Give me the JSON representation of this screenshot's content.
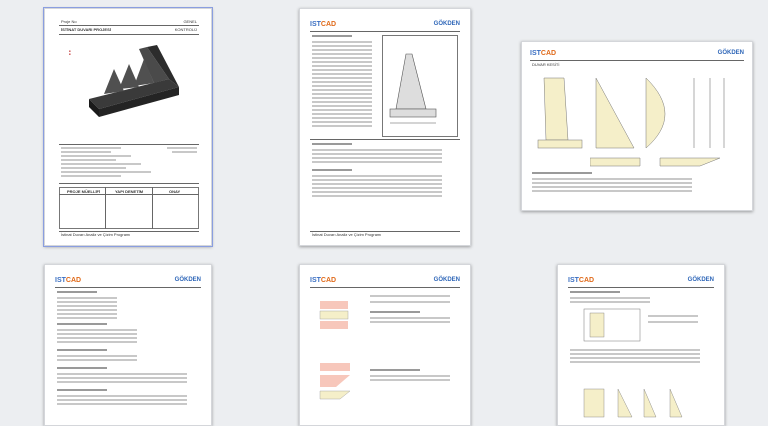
{
  "pages": [
    {
      "label": "page-1",
      "header_left": "Proje No",
      "header_right": "GENEL",
      "title": "İSTİNAT DUVARI PROJESİ",
      "title_right": "KONTROLÜ",
      "table_headers": [
        "PROJE MÜELLİFİ",
        "YAPI DENETİM",
        "ONAY"
      ],
      "footer": "İstinat Duvarı Analiz ve Çizim Programı"
    },
    {
      "label": "page-2",
      "logo_a": "IST",
      "logo_b": "CAD",
      "brand": "GÖKDEN",
      "footer": "İstinat Duvarı Analiz ve Çizim Programı"
    },
    {
      "label": "page-3",
      "logo_a": "IST",
      "logo_b": "CAD",
      "brand": "GÖKDEN",
      "section": "DUVAR KESİTİ"
    },
    {
      "label": "page-4",
      "logo_a": "IST",
      "logo_b": "CAD",
      "brand": "GÖKDEN"
    },
    {
      "label": "page-5",
      "logo_a": "IST",
      "logo_b": "CAD",
      "brand": "GÖKDEN"
    },
    {
      "label": "page-6",
      "logo_a": "IST",
      "logo_b": "CAD",
      "brand": "GÖKDEN"
    }
  ],
  "colors": {
    "background": "#eceef1",
    "selection": "#8a9ee0",
    "logo_blue": "#3a6ec2",
    "logo_orange": "#e06a1a",
    "wall_fill": "#f5efc9",
    "pink_fill": "#f7c7bb"
  }
}
